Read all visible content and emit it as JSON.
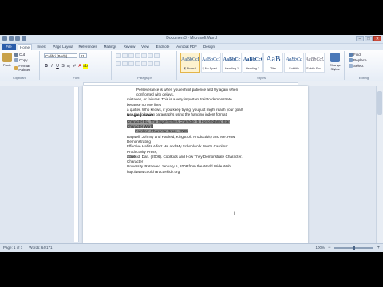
{
  "window": {
    "title": "Document3 - Microsoft Word",
    "minimize": "–",
    "maximize": "□",
    "close": "✕"
  },
  "tabs": [
    "File",
    "Home",
    "Insert",
    "Page Layout",
    "References",
    "Mailings",
    "Review",
    "View",
    "Endnote",
    "Acrobat PDF",
    "Design"
  ],
  "ribbon": {
    "clipboard": {
      "paste": "Paste",
      "cut": "Cut",
      "copy": "Copy",
      "format_painter": "Format Painter",
      "label": "Clipboard"
    },
    "font": {
      "name": "Calibri (Body)",
      "size": "11",
      "label": "Font"
    },
    "paragraph": {
      "label": "Paragraph"
    },
    "styles": {
      "items": [
        {
          "preview": "AaBbCcDc",
          "name": "¶ Normal"
        },
        {
          "preview": "AaBbCcDc",
          "name": "¶ No Spaci..."
        },
        {
          "preview": "AaBbCc",
          "name": "Heading 1"
        },
        {
          "preview": "AaBbCcC",
          "name": "Heading 2"
        },
        {
          "preview": "AaB",
          "name": "Title"
        },
        {
          "preview": "AaBbCc",
          "name": "Subtitle"
        },
        {
          "preview": "AaBbCcL",
          "name": "Subtle Em..."
        }
      ],
      "change_styles": "Change Styles",
      "label": "Styles"
    },
    "editing": {
      "find": "Find",
      "replace": "Replace",
      "select": "Select",
      "label": "Editing"
    }
  },
  "document": {
    "para1": [
      "Perseverance is when you exhibit patience and try again when confronted with delays,",
      "mistakes, or failures. This is a very important trait to demonstrate because no one likes",
      "a quitter. Who knows, if you keep trying, you just might reach your goal!",
      "Key the following paragraphs using the hanging indent format."
    ],
    "heading": "Hanging Indent",
    "cite1_hl": [
      "Character Ed, The Super Ethics Character 5. Honoredaria: Star Character World",
      "Carolina: Character Press, 2009."
    ],
    "cite2": [
      "Bagwell, Johnny and Hatfield, Kingstroll. Productivity and Me: How Demonstrating",
      "Effective Habits Affect Me and My Schoolwork. North Carolina: Productivity Press,",
      "2004."
    ],
    "cite3": [
      "CoolKid, Dan. (2006). CoolKids and How They Demonstrate Character. Character",
      "University. Retrieved January 5, 2008 from the World Wide Web:",
      "http://www.coolcharacterkidz.org."
    ]
  },
  "status": {
    "page": "Page: 1 of 1",
    "words": "Words: 64/171",
    "zoom": "100%"
  }
}
